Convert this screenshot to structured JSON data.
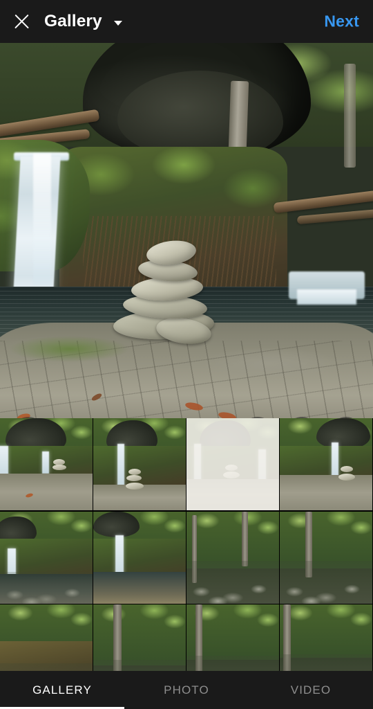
{
  "header": {
    "close_icon": "close-icon",
    "title": "Gallery",
    "dropdown_icon": "chevron-down-icon",
    "next_label": "Next",
    "next_color": "#3897f0",
    "background": "#1a1a1a"
  },
  "preview": {
    "description": "Stone cairn stacked on rock ledge beside waterfall and stream",
    "controls": {
      "expand_icon": "expand-crop-icon",
      "boomerang_icon": "infinity-boomerang-icon",
      "layout_icon": "layout-grid-icon",
      "multiselect_icon": "multi-select-stacked-icon"
    }
  },
  "gallery_grid": {
    "columns": 4,
    "thumbnails": [
      {
        "id": 1,
        "scene": "waterfall-cairn-ledge",
        "selected": false
      },
      {
        "id": 2,
        "scene": "boulder-waterfall-cairn",
        "selected": false
      },
      {
        "id": 3,
        "scene": "waterfall-cairn-faded",
        "selected": true
      },
      {
        "id": 4,
        "scene": "boulder-waterfall-cairn-2",
        "selected": false
      },
      {
        "id": 5,
        "scene": "waterfall-forest-pool",
        "selected": false
      },
      {
        "id": 6,
        "scene": "waterfall-stream-pool",
        "selected": false
      },
      {
        "id": 7,
        "scene": "forest-rocky-stream",
        "selected": false
      },
      {
        "id": 8,
        "scene": "forest-rocky-creek",
        "selected": false
      },
      {
        "id": 9,
        "scene": "forest-cliff-face",
        "selected": false
      },
      {
        "id": 10,
        "scene": "forest-trunk-rocks",
        "selected": false
      },
      {
        "id": 11,
        "scene": "forest-creek-person",
        "selected": false
      },
      {
        "id": 12,
        "scene": "forest-boulders-person",
        "selected": false
      }
    ]
  },
  "tabs": {
    "items": [
      {
        "label": "GALLERY",
        "active": true
      },
      {
        "label": "PHOTO",
        "active": false
      },
      {
        "label": "VIDEO",
        "active": false
      }
    ],
    "active_color": "#ffffff",
    "inactive_color": "#8e8e8e"
  }
}
